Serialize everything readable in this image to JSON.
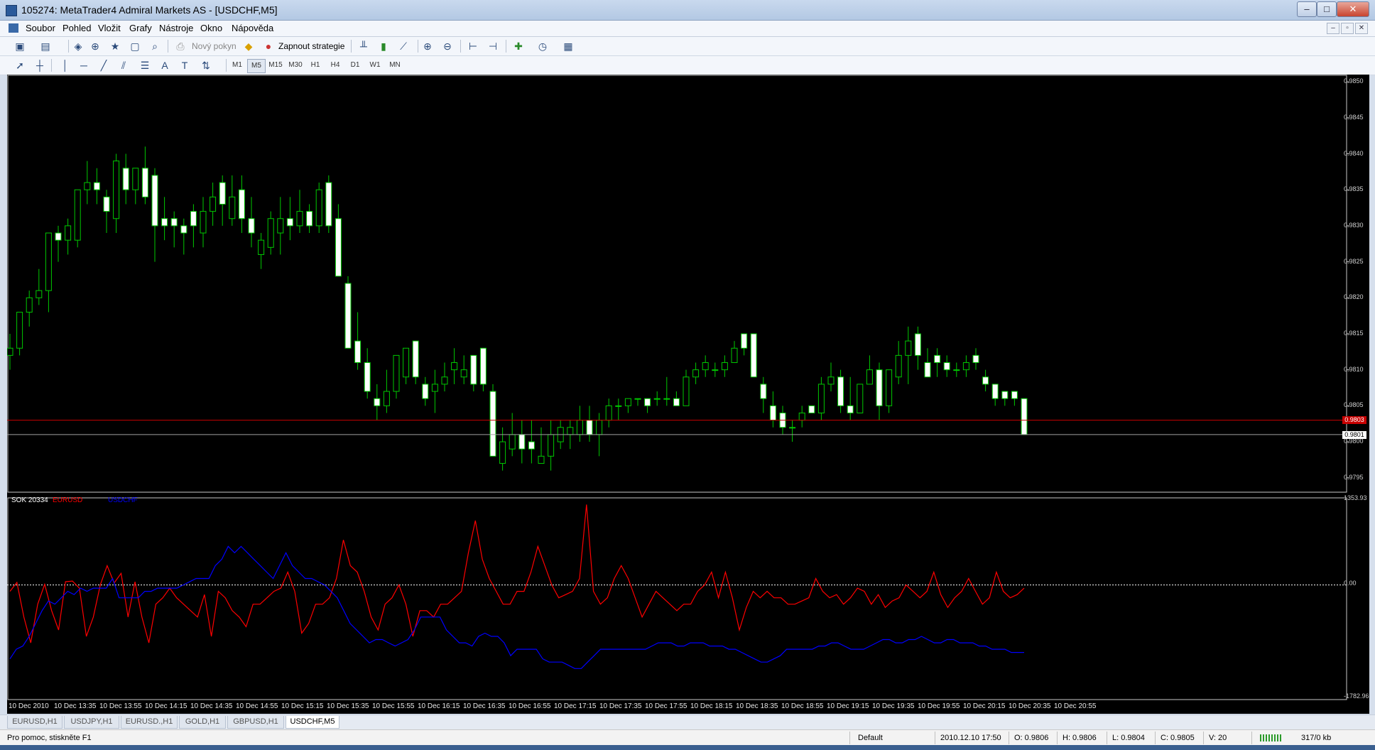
{
  "window": {
    "title": "105274: MetaTrader4 Admiral Markets AS - [USDCHF,M5]",
    "buttons": {
      "minimize": "–",
      "maximize": "□",
      "close": "✕"
    }
  },
  "menu": [
    "Soubor",
    "Pohled",
    "Vložit",
    "Grafy",
    "Nástroje",
    "Okno",
    "Nápověda"
  ],
  "mdi_buttons": {
    "minimize": "–",
    "restore": "▫",
    "close": "✕"
  },
  "toolbar": {
    "new_order_label": "Nový pokyn",
    "strategy_label": "Zapnout strategie",
    "timeframes": [
      "M1",
      "M5",
      "M15",
      "M30",
      "H1",
      "H4",
      "D1",
      "W1",
      "MN"
    ],
    "active_timeframe": "M5"
  },
  "chart": {
    "symbol": "USDCHF,M5",
    "price_axis": [
      "0.9850",
      "0.9845",
      "0.9840",
      "0.9835",
      "0.9830",
      "0.9825",
      "0.9820",
      "0.9815",
      "0.9810",
      "0.9805",
      "0.9800",
      "0.9795"
    ],
    "bid_label": "0.9801",
    "ask_label": "0.9803",
    "up_color": "#00c800",
    "down_color": "#ffffff",
    "ask_line_color": "#c80000",
    "time_axis": [
      "10 Dec 2010",
      "10 Dec 13:35",
      "10 Dec 13:55",
      "10 Dec 14:15",
      "10 Dec 14:35",
      "10 Dec 14:55",
      "10 Dec 15:15",
      "10 Dec 15:35",
      "10 Dec 15:55",
      "10 Dec 16:15",
      "10 Dec 16:35",
      "10 Dec 16:55",
      "10 Dec 17:15",
      "10 Dec 17:35",
      "10 Dec 17:55",
      "10 Dec 18:15",
      "10 Dec 18:35",
      "10 Dec 18:55",
      "10 Dec 19:15",
      "10 Dec 19:35",
      "10 Dec 19:55",
      "10 Dec 20:15",
      "10 Dec 20:35",
      "10 Dec 20:55"
    ]
  },
  "indicator": {
    "name": "SOK 20334",
    "series_names": [
      "EURUSD",
      "USDCHF"
    ],
    "series_colors": [
      "#ff0000",
      "#0000ff"
    ],
    "axis_labels": [
      "1353.93",
      "0.00",
      "-1782.96"
    ]
  },
  "tabs": [
    "EURUSD,H1",
    "USDJPY,H1",
    "EURUSD.,H1",
    "GOLD,H1",
    "GBPUSD,H1",
    "USDCHF,M5"
  ],
  "active_tab": "USDCHF,M5",
  "status": {
    "help": "Pro pomoc, stiskněte F1",
    "profile": "Default",
    "datetime": "2010.12.10 17:50",
    "open": "O: 0.9806",
    "high": "H: 0.9806",
    "low": "L: 0.9804",
    "close": "C: 0.9805",
    "volume": "V: 20",
    "traffic": "317/0 kb"
  },
  "chart_data": {
    "type": "candlestick",
    "ohlc": [
      [
        0.9812,
        0.9815,
        0.981,
        0.9813
      ],
      [
        0.9813,
        0.9818,
        0.9812,
        0.9818
      ],
      [
        0.9818,
        0.9821,
        0.9816,
        0.982
      ],
      [
        0.982,
        0.9824,
        0.9819,
        0.9821
      ],
      [
        0.9821,
        0.9829,
        0.9818,
        0.9829
      ],
      [
        0.9829,
        0.983,
        0.9825,
        0.9828
      ],
      [
        0.9828,
        0.9831,
        0.9826,
        0.983
      ],
      [
        0.9828,
        0.9835,
        0.9827,
        0.9835
      ],
      [
        0.9835,
        0.9839,
        0.9833,
        0.9836
      ],
      [
        0.9836,
        0.9838,
        0.9833,
        0.9835
      ],
      [
        0.9834,
        0.9835,
        0.9829,
        0.9832
      ],
      [
        0.9831,
        0.984,
        0.9829,
        0.9839
      ],
      [
        0.9838,
        0.984,
        0.9833,
        0.9835
      ],
      [
        0.9835,
        0.9838,
        0.9833,
        0.9838
      ],
      [
        0.9838,
        0.9841,
        0.9833,
        0.9834
      ],
      [
        0.9837,
        0.9838,
        0.9825,
        0.983
      ],
      [
        0.9831,
        0.9834,
        0.9828,
        0.983
      ],
      [
        0.9831,
        0.9832,
        0.9827,
        0.983
      ],
      [
        0.983,
        0.9831,
        0.9826,
        0.9829
      ],
      [
        0.9832,
        0.9833,
        0.9827,
        0.983
      ],
      [
        0.9829,
        0.9834,
        0.9827,
        0.9832
      ],
      [
        0.9832,
        0.9836,
        0.983,
        0.9834
      ],
      [
        0.9836,
        0.9837,
        0.983,
        0.9833
      ],
      [
        0.9831,
        0.9837,
        0.983,
        0.9834
      ],
      [
        0.9835,
        0.9837,
        0.9829,
        0.9831
      ],
      [
        0.9831,
        0.9834,
        0.9827,
        0.9829
      ],
      [
        0.9826,
        0.9829,
        0.9824,
        0.9828
      ],
      [
        0.9827,
        0.9832,
        0.9826,
        0.9831
      ],
      [
        0.9829,
        0.9834,
        0.9826,
        0.9831
      ],
      [
        0.9831,
        0.9834,
        0.9828,
        0.983
      ],
      [
        0.983,
        0.9835,
        0.9829,
        0.9832
      ],
      [
        0.9832,
        0.9833,
        0.9829,
        0.983
      ],
      [
        0.983,
        0.9836,
        0.9829,
        0.9835
      ],
      [
        0.9836,
        0.9837,
        0.9829,
        0.983
      ],
      [
        0.9831,
        0.9833,
        0.9823,
        0.9823
      ],
      [
        0.9822,
        0.9823,
        0.9813,
        0.9813
      ],
      [
        0.9814,
        0.9818,
        0.981,
        0.9811
      ],
      [
        0.9811,
        0.9813,
        0.9806,
        0.9807
      ],
      [
        0.9806,
        0.9808,
        0.9803,
        0.9805
      ],
      [
        0.9805,
        0.981,
        0.9804,
        0.9807
      ],
      [
        0.9807,
        0.9812,
        0.9806,
        0.9812
      ],
      [
        0.9809,
        0.9813,
        0.9808,
        0.9813
      ],
      [
        0.9814,
        0.9814,
        0.9808,
        0.9809
      ],
      [
        0.9808,
        0.9809,
        0.9805,
        0.9806
      ],
      [
        0.9807,
        0.981,
        0.9804,
        0.9808
      ],
      [
        0.9808,
        0.9811,
        0.9807,
        0.9809
      ],
      [
        0.981,
        0.9813,
        0.9808,
        0.9811
      ],
      [
        0.9809,
        0.9812,
        0.9808,
        0.981
      ],
      [
        0.9812,
        0.9812,
        0.9807,
        0.9808
      ],
      [
        0.9813,
        0.9812,
        0.9807,
        0.9808
      ],
      [
        0.9807,
        0.9808,
        0.9798,
        0.9798
      ],
      [
        0.9797,
        0.9802,
        0.9796,
        0.98
      ],
      [
        0.9799,
        0.9804,
        0.9798,
        0.9801
      ],
      [
        0.9801,
        0.9803,
        0.9797,
        0.9799
      ],
      [
        0.98,
        0.9803,
        0.9797,
        0.9799
      ],
      [
        0.9797,
        0.9802,
        0.9797,
        0.9798
      ],
      [
        0.9798,
        0.9803,
        0.9796,
        0.9801
      ],
      [
        0.98,
        0.9803,
        0.9799,
        0.9802
      ],
      [
        0.9801,
        0.9803,
        0.9799,
        0.9802
      ],
      [
        0.9801,
        0.9805,
        0.98,
        0.9803
      ],
      [
        0.9803,
        0.9805,
        0.98,
        0.9801
      ],
      [
        0.9801,
        0.9804,
        0.9798,
        0.9803
      ],
      [
        0.9803,
        0.9806,
        0.9802,
        0.9805
      ],
      [
        0.9805,
        0.9806,
        0.9803,
        0.9805
      ],
      [
        0.9805,
        0.9806,
        0.9804,
        0.9806
      ],
      [
        0.9806,
        0.9806,
        0.9805,
        0.9806
      ],
      [
        0.9806,
        0.9806,
        0.9804,
        0.9805
      ],
      [
        0.9806,
        0.9807,
        0.9805,
        0.9806
      ],
      [
        0.9806,
        0.9809,
        0.9805,
        0.9806
      ],
      [
        0.9806,
        0.9807,
        0.9805,
        0.9805
      ],
      [
        0.9805,
        0.981,
        0.9805,
        0.9809
      ],
      [
        0.9809,
        0.9811,
        0.9808,
        0.981
      ],
      [
        0.981,
        0.9812,
        0.9809,
        0.9811
      ],
      [
        0.981,
        0.9811,
        0.9809,
        0.981
      ],
      [
        0.981,
        0.9812,
        0.9809,
        0.9811
      ],
      [
        0.9811,
        0.9814,
        0.9811,
        0.9813
      ],
      [
        0.9815,
        0.9815,
        0.9812,
        0.9813
      ],
      [
        0.9815,
        0.9815,
        0.9809,
        0.9809
      ],
      [
        0.9808,
        0.9809,
        0.9804,
        0.9806
      ],
      [
        0.9805,
        0.9807,
        0.9802,
        0.9803
      ],
      [
        0.9804,
        0.9805,
        0.9801,
        0.9802
      ],
      [
        0.9802,
        0.9803,
        0.98,
        0.9802
      ],
      [
        0.9803,
        0.9805,
        0.9802,
        0.9804
      ],
      [
        0.9805,
        0.9805,
        0.9804,
        0.9804
      ],
      [
        0.9804,
        0.9809,
        0.9803,
        0.9808
      ],
      [
        0.9808,
        0.9811,
        0.9807,
        0.9809
      ],
      [
        0.9809,
        0.981,
        0.9804,
        0.9805
      ],
      [
        0.9805,
        0.9809,
        0.9803,
        0.9804
      ],
      [
        0.9804,
        0.9808,
        0.9804,
        0.9808
      ],
      [
        0.9808,
        0.9812,
        0.9808,
        0.981
      ],
      [
        0.981,
        0.9811,
        0.9803,
        0.9805
      ],
      [
        0.9805,
        0.981,
        0.9804,
        0.981
      ],
      [
        0.9809,
        0.9814,
        0.9808,
        0.9812
      ],
      [
        0.9812,
        0.9816,
        0.9808,
        0.9814
      ],
      [
        0.9815,
        0.9816,
        0.981,
        0.9812
      ],
      [
        0.9811,
        0.9813,
        0.9809,
        0.9809
      ],
      [
        0.9812,
        0.9813,
        0.9809,
        0.9811
      ],
      [
        0.9811,
        0.9812,
        0.9809,
        0.981
      ],
      [
        0.981,
        0.9811,
        0.9809,
        0.981
      ],
      [
        0.981,
        0.9812,
        0.9809,
        0.9811
      ],
      [
        0.9812,
        0.9813,
        0.981,
        0.9811
      ],
      [
        0.9809,
        0.981,
        0.9807,
        0.9808
      ],
      [
        0.9808,
        0.9808,
        0.9805,
        0.9806
      ],
      [
        0.9807,
        0.9807,
        0.9805,
        0.9806
      ],
      [
        0.9807,
        0.9807,
        0.9805,
        0.9806
      ],
      [
        0.9806,
        0.9806,
        0.9801,
        0.9801
      ]
    ],
    "bid": 0.9801,
    "ask": 0.9803,
    "ylim": [
      0.9793,
      0.9851
    ],
    "indicator_series": [
      {
        "name": "EURUSD",
        "values": [
          -100,
          40,
          -500,
          -900,
          -300,
          10,
          -400,
          -700,
          50,
          60,
          -50,
          -800,
          -500,
          0,
          300,
          30,
          180,
          -500,
          50,
          -500,
          -900,
          -300,
          -200,
          -50,
          -200,
          -300,
          -400,
          -500,
          -150,
          -800,
          -100,
          -200,
          -400,
          -500,
          -650,
          -300,
          -300,
          -200,
          -100,
          -50,
          200,
          -100,
          -750,
          -600,
          -300,
          -300,
          -200,
          100,
          700,
          300,
          200,
          -100,
          -500,
          -700,
          -300,
          -200,
          0,
          -300,
          -800,
          -400,
          -400,
          -500,
          -300,
          -300,
          -200,
          -100,
          500,
          1000,
          400,
          100,
          -100,
          -300,
          -300,
          -100,
          -100,
          200,
          600,
          300,
          0,
          -200,
          -150,
          -100,
          100,
          1250,
          -100,
          -300,
          -200,
          100,
          300,
          100,
          -200,
          -500,
          -300,
          -100,
          -200,
          -300,
          -400,
          -300,
          -300,
          -100,
          0,
          200,
          -200,
          200,
          -200,
          -700,
          -350,
          -100,
          -200,
          -100,
          -200,
          -200,
          -300,
          -300,
          -250,
          -200,
          100,
          -100,
          -200,
          -150,
          -300,
          -200,
          -50,
          -100,
          -300,
          -150,
          -350,
          -250,
          -200,
          0,
          -100,
          -200,
          -100,
          200,
          -150,
          -350,
          -200,
          -100,
          100,
          -100,
          -300,
          -200,
          200,
          -100,
          -200,
          -150,
          -50
        ]
      },
      {
        "name": "USDCHF",
        "values": [
          -1150,
          -1000,
          -950,
          -800,
          -600,
          -400,
          -250,
          -300,
          -200,
          -100,
          -150,
          -50,
          -100,
          -50,
          -50,
          -50,
          100,
          -200,
          -200,
          -200,
          -200,
          -100,
          -100,
          -50,
          -50,
          -50,
          -50,
          0,
          50,
          100,
          100,
          100,
          300,
          400,
          600,
          500,
          600,
          500,
          400,
          300,
          200,
          100,
          300,
          500,
          300,
          200,
          100,
          100,
          50,
          0,
          -100,
          -200,
          -400,
          -600,
          -700,
          -800,
          -900,
          -850,
          -850,
          -900,
          -950,
          -900,
          -850,
          -700,
          -500,
          -500,
          -500,
          -500,
          -700,
          -800,
          -900,
          -900,
          -950,
          -800,
          -750,
          -800,
          -800,
          -900,
          -1100,
          -1000,
          -1000,
          -1000,
          -1000,
          -1150,
          -1200,
          -1200,
          -1200,
          -1250,
          -1300,
          -1300,
          -1200,
          -1100,
          -1000,
          -1000,
          -1000,
          -1000,
          -1000,
          -1000,
          -1000,
          -1000,
          -950,
          -900,
          -900,
          -900,
          -950,
          -950,
          -900,
          -900,
          -900,
          -950,
          -950,
          -950,
          -1000,
          -1000,
          -1050,
          -1100,
          -1150,
          -1200,
          -1200,
          -1150,
          -1100,
          -1000,
          -1000,
          -1000,
          -1000,
          -1000,
          -950,
          -950,
          -900,
          -900,
          -950,
          -1000,
          -1000,
          -1000,
          -950,
          -900,
          -850,
          -850,
          -900,
          -900,
          -850,
          -850,
          -800,
          -850,
          -900,
          -900,
          -850,
          -850,
          -900,
          -900,
          -900,
          -950,
          -950,
          -1000,
          -1000,
          -1000,
          -1050,
          -1050,
          -1050
        ]
      }
    ],
    "indicator_ylim": [
      -1782.96,
      1353.93
    ]
  }
}
